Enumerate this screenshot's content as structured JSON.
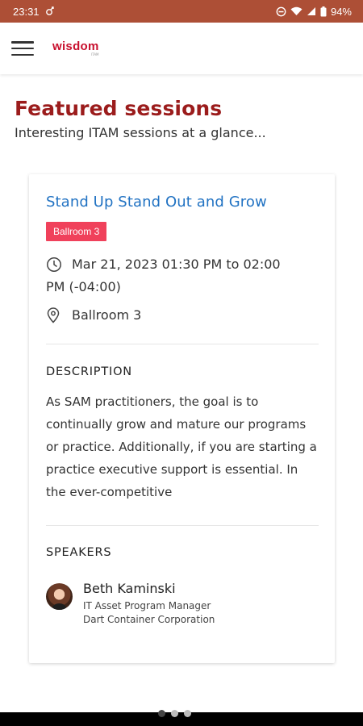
{
  "status_bar": {
    "time": "23:31",
    "battery": "94%",
    "background_color": "#ad4f36",
    "icons": [
      "notification-icon",
      "do-not-disturb-icon",
      "wifi-icon",
      "signal-icon",
      "battery-icon"
    ]
  },
  "app_bar": {
    "menu_icon": "hamburger-menu-icon",
    "logo_text": "wisdom",
    "logo_sub": "ITAM",
    "brand_color": "#c8102e"
  },
  "page": {
    "title": "Featured sessions",
    "subtitle": "Interesting ITAM sessions at a glance...",
    "title_color": "#9b1c1c"
  },
  "session": {
    "title": "Stand Up Stand Out and Grow",
    "title_color": "#2273c3",
    "room_badge": "Ballroom 3",
    "badge_color": "#f0415b",
    "time_line1": "Mar 21, 2023 01:30 PM to 02:00",
    "time_line2": "PM (-04:00)",
    "location": "Ballroom 3",
    "description_heading": "DESCRIPTION",
    "description": "As SAM practitioners, the goal is to continually grow and mature our programs or practice. Additionally, if you are starting a practice executive support is essential. In the ever-competitive",
    "speakers_heading": "SPEAKERS",
    "speakers": [
      {
        "name": "Beth Kaminski",
        "role": "IT Asset Program Manager",
        "organization": "Dart Container Corporation"
      }
    ]
  },
  "pager": {
    "count": 3,
    "active_index": 0
  }
}
